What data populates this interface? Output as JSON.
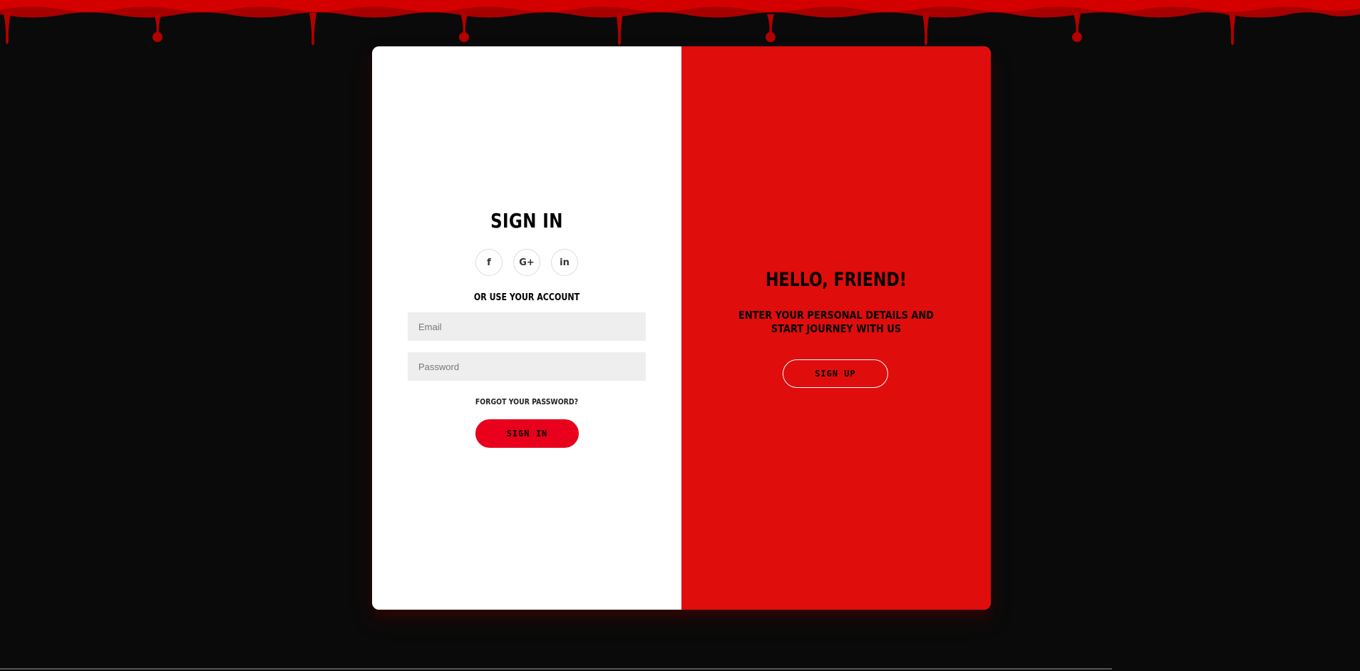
{
  "theme": {
    "background": "#0a0a0a",
    "blood_red": "#c40000",
    "accent_red": "#e00d0d",
    "button_red": "#e8001c"
  },
  "signin": {
    "title": "SIGN IN",
    "social_icons": [
      {
        "name": "facebook-icon",
        "glyph": "f"
      },
      {
        "name": "google-plus-icon",
        "glyph": "G+"
      },
      {
        "name": "linkedin-icon",
        "glyph": "in"
      }
    ],
    "subtext": "OR USE YOUR ACCOUNT",
    "email_placeholder": "Email",
    "password_placeholder": "Password",
    "forgot_label": "FORGOT YOUR PASSWORD?",
    "button_label": "SIGN IN"
  },
  "overlay": {
    "title": "HELLO, FRIEND!",
    "text": "ENTER YOUR PERSONAL DETAILS AND START JOURNEY WITH US",
    "button_label": "SIGN UP"
  }
}
